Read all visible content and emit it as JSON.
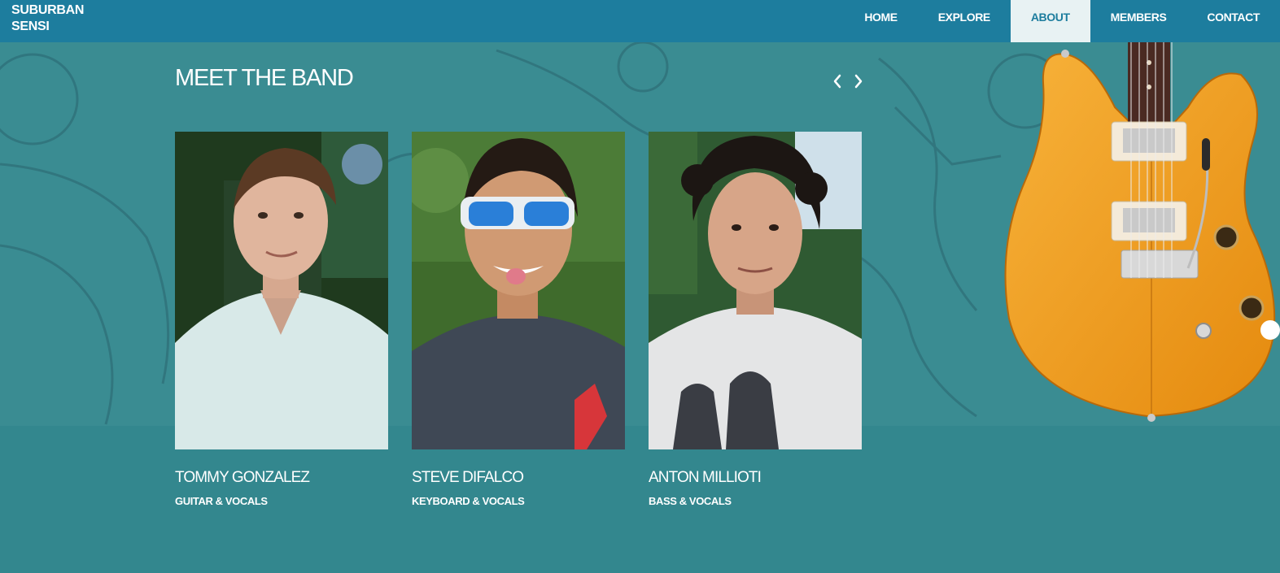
{
  "brand": {
    "line1": "SUBURBAN",
    "line2": "SENSI"
  },
  "nav": [
    {
      "label": "HOME",
      "active": false
    },
    {
      "label": "EXPLORE",
      "active": false
    },
    {
      "label": "ABOUT",
      "active": true
    },
    {
      "label": "MEMBERS",
      "active": false
    },
    {
      "label": "CONTACT",
      "active": false
    }
  ],
  "section": {
    "title": "MEET THE BAND"
  },
  "members": [
    {
      "name": "TOMMY GONZALEZ",
      "role": "GUITAR & VOCALS"
    },
    {
      "name": "STEVE DIFALCO",
      "role": "KEYBOARD & VOCALS"
    },
    {
      "name": "ANTON MILLIOTI",
      "role": "BASS & VOCALS"
    }
  ],
  "colors": {
    "nav": "#1d7d9e",
    "page": "#33878e",
    "hero": "#3a8c92",
    "active_tab": "#e8f2f3"
  },
  "icons": {
    "prev": "chevron-left-icon",
    "next": "chevron-right-icon"
  }
}
